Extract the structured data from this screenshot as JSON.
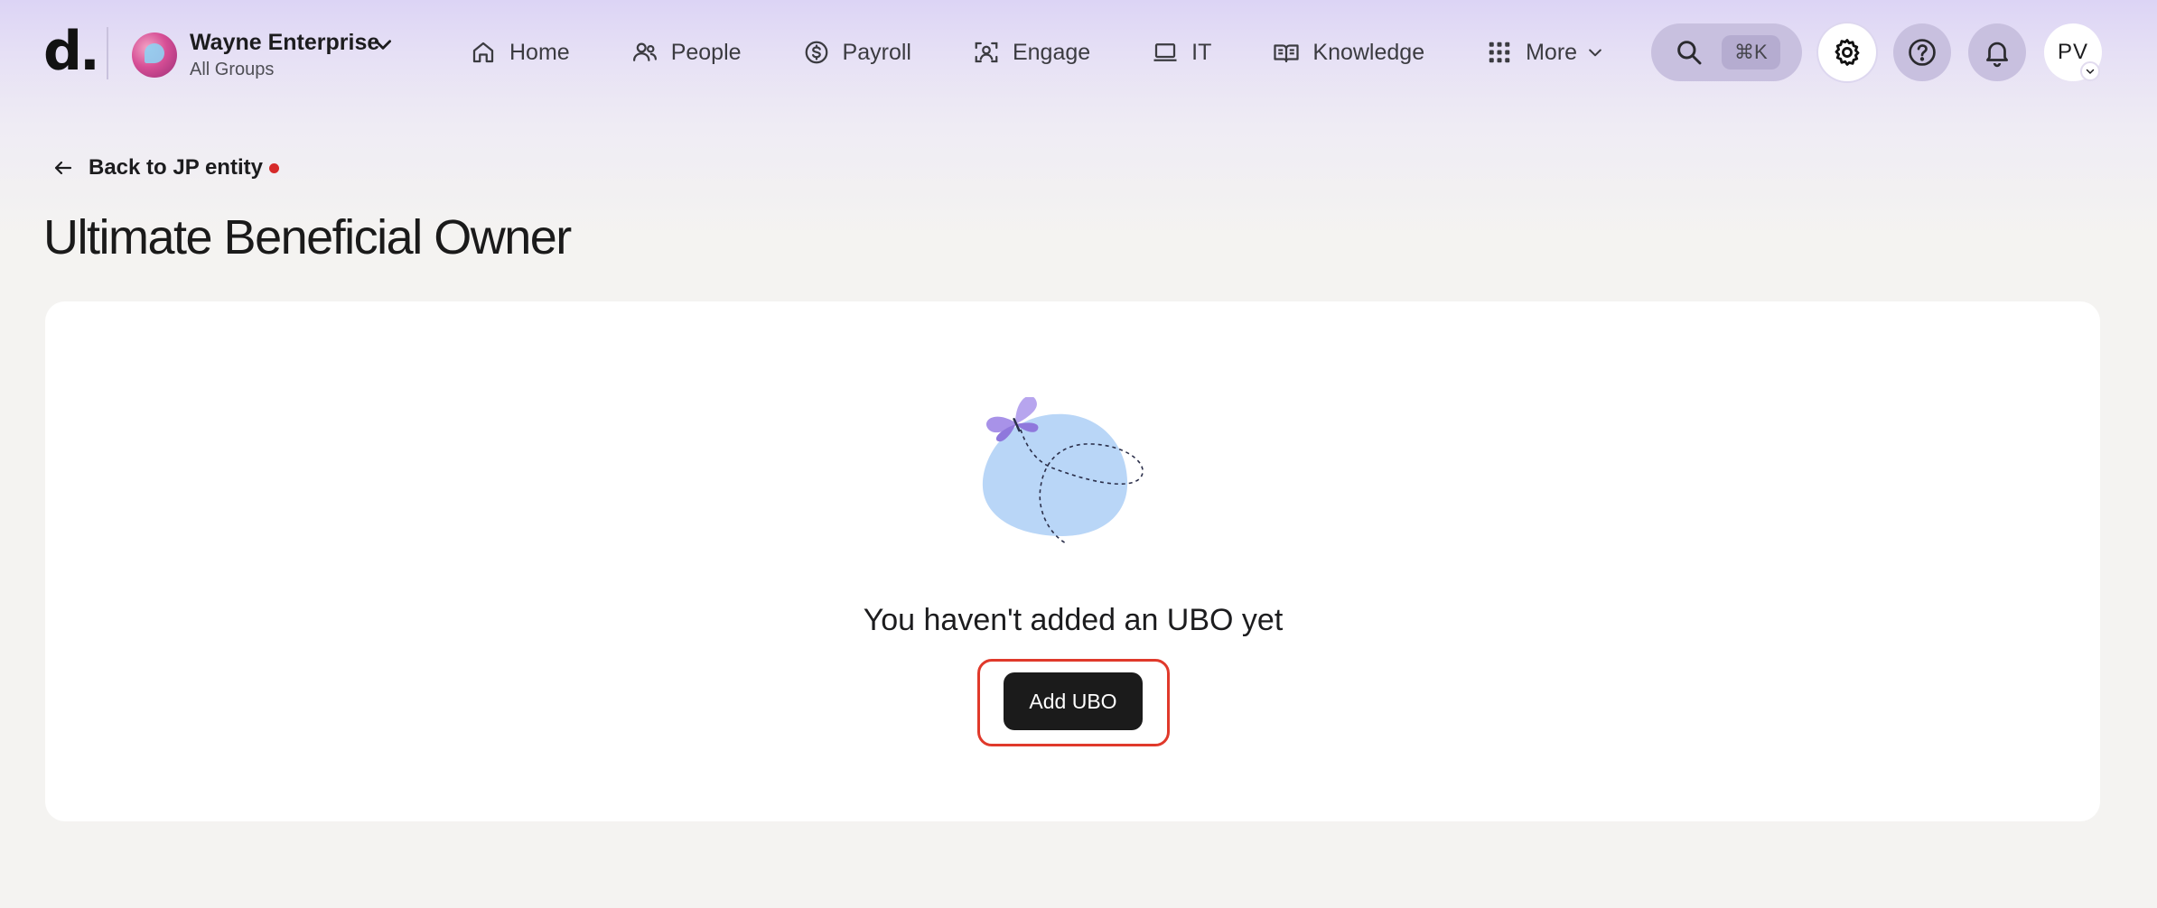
{
  "brand": {
    "logo_text": "d."
  },
  "org": {
    "name": "Wayne Enterprise",
    "subtitle": "All Groups"
  },
  "nav": {
    "items": [
      {
        "label": "Home",
        "icon": "home-icon"
      },
      {
        "label": "People",
        "icon": "people-icon"
      },
      {
        "label": "Payroll",
        "icon": "dollar-icon"
      },
      {
        "label": "Engage",
        "icon": "engage-icon"
      },
      {
        "label": "IT",
        "icon": "laptop-icon"
      },
      {
        "label": "Knowledge",
        "icon": "book-icon"
      },
      {
        "label": "More",
        "icon": "grid-icon"
      }
    ]
  },
  "search": {
    "shortcut": "⌘K"
  },
  "user": {
    "initials": "PV"
  },
  "page": {
    "back_label": "Back to JP entity",
    "title": "Ultimate Beneficial Owner"
  },
  "empty_state": {
    "message": "You haven't added an UBO yet",
    "button_label": "Add UBO"
  },
  "colors": {
    "accent_highlight": "#e0392b",
    "primary_button": "#1b1b1b",
    "notification_dot": "#d62a2a",
    "illustration_blob": "#b9d6f7",
    "butterfly": "#a892e8"
  }
}
